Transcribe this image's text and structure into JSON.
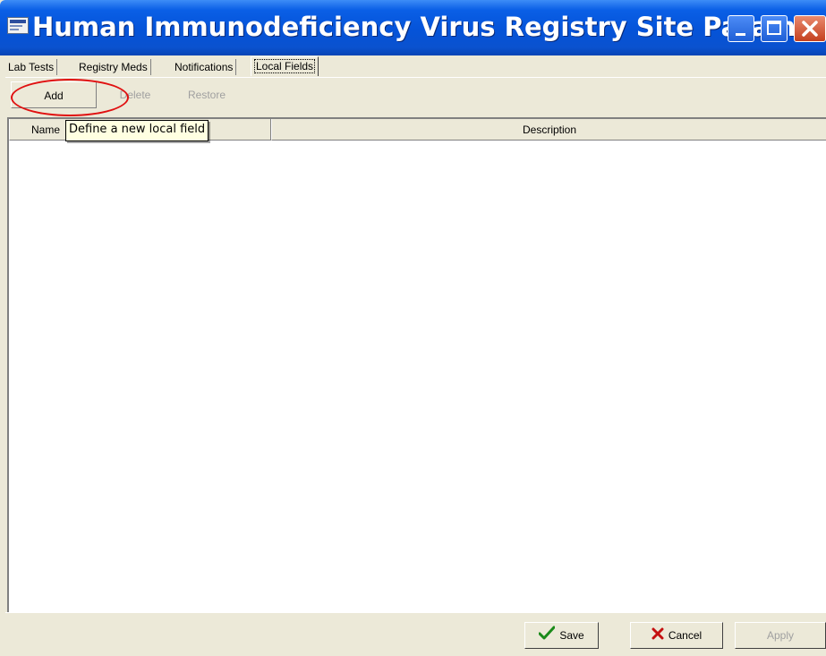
{
  "window": {
    "title": "Human Immunodeficiency Virus Registry Site Parame...",
    "app_icon": "registry-app-icon",
    "controls": [
      "minimize-icon",
      "maximize-icon",
      "close-icon"
    ]
  },
  "tabs": [
    {
      "label": "Lab Tests",
      "active": false
    },
    {
      "label": "Registry Meds",
      "active": false
    },
    {
      "label": "Notifications",
      "active": false
    },
    {
      "label": "Local Fields",
      "active": true
    }
  ],
  "toolbar": {
    "add_label": "Add",
    "delete_label": "Delete",
    "restore_label": "Restore"
  },
  "list": {
    "columns": [
      "Name",
      "Description"
    ],
    "rows": []
  },
  "tooltip": "Define a new local field",
  "footer": {
    "save_label": "Save",
    "cancel_label": "Cancel",
    "apply_label": "Apply"
  },
  "colors": {
    "titlebar": "#0553d8",
    "tooltip_bg": "#ffffe1",
    "highlight_circle": "#e01010",
    "save_check": "#1a8a1a",
    "cancel_x": "#c41010"
  }
}
